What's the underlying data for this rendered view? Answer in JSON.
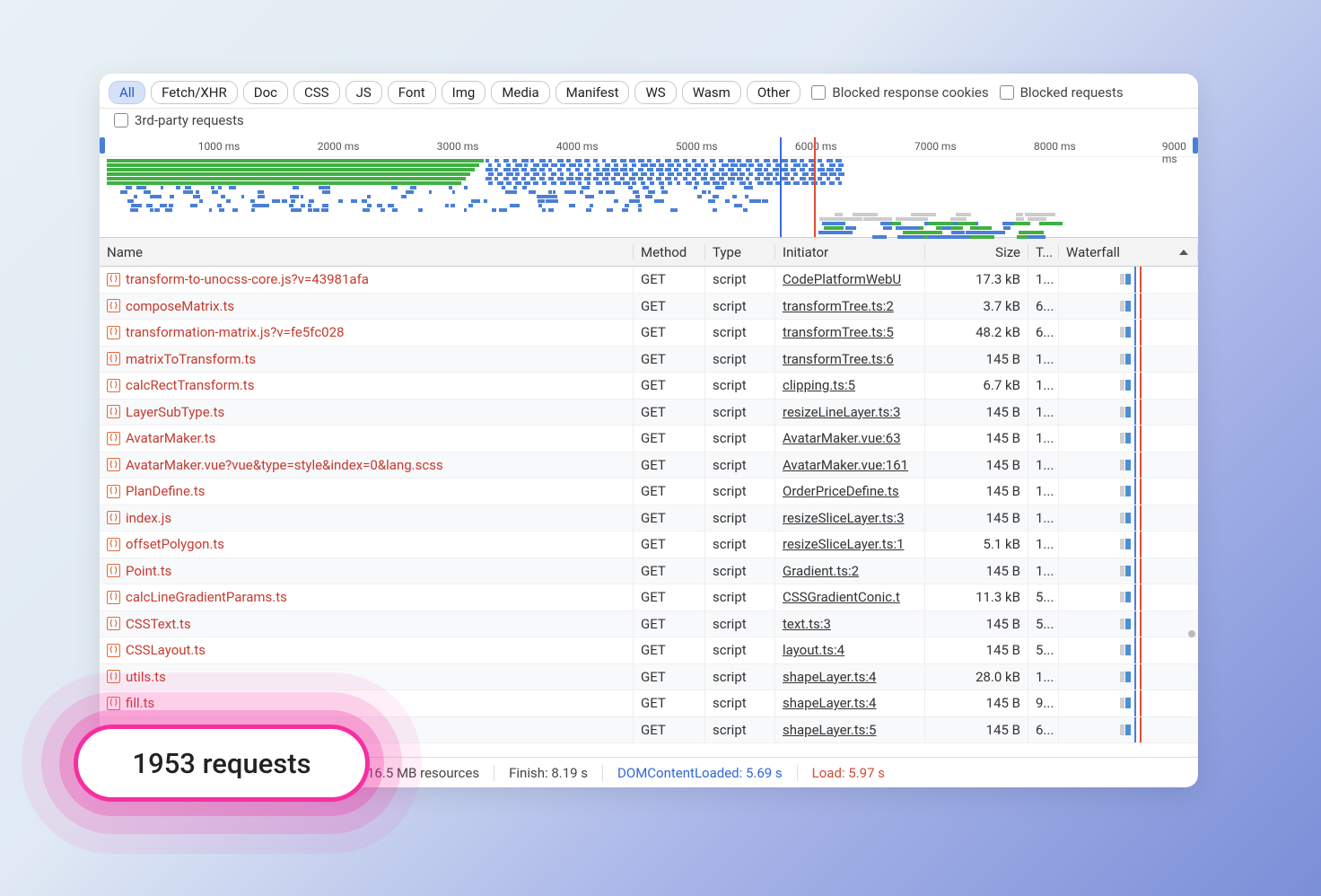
{
  "filters": {
    "chips": [
      "All",
      "Fetch/XHR",
      "Doc",
      "CSS",
      "JS",
      "Font",
      "Img",
      "Media",
      "Manifest",
      "WS",
      "Wasm",
      "Other"
    ],
    "active": "All",
    "checks": {
      "blocked_cookies": "Blocked response cookies",
      "blocked_requests": "Blocked requests",
      "third_party": "3rd-party requests"
    }
  },
  "timeline": {
    "ticks": [
      "1000 ms",
      "2000 ms",
      "3000 ms",
      "4000 ms",
      "5000 ms",
      "6000 ms",
      "7000 ms",
      "8000 ms",
      "9000 ms"
    ]
  },
  "columns": {
    "name": "Name",
    "method": "Method",
    "type": "Type",
    "initiator": "Initiator",
    "size": "Size",
    "time": "T...",
    "waterfall": "Waterfall"
  },
  "rows": [
    {
      "name": "transform-to-unocss-core.js?v=43981afa",
      "method": "GET",
      "type": "script",
      "initiator": "CodePlatformWebU",
      "size": "17.3 kB",
      "time": "1..."
    },
    {
      "name": "composeMatrix.ts",
      "method": "GET",
      "type": "script",
      "initiator": "transformTree.ts:2",
      "size": "3.7 kB",
      "time": "6..."
    },
    {
      "name": "transformation-matrix.js?v=fe5fc028",
      "method": "GET",
      "type": "script",
      "initiator": "transformTree.ts:5",
      "size": "48.2 kB",
      "time": "6..."
    },
    {
      "name": "matrixToTransform.ts",
      "method": "GET",
      "type": "script",
      "initiator": "transformTree.ts:6",
      "size": "145 B",
      "time": "1..."
    },
    {
      "name": "calcRectTransform.ts",
      "method": "GET",
      "type": "script",
      "initiator": "clipping.ts:5",
      "size": "6.7 kB",
      "time": "1..."
    },
    {
      "name": "LayerSubType.ts",
      "method": "GET",
      "type": "script",
      "initiator": "resizeLineLayer.ts:3",
      "size": "145 B",
      "time": "1..."
    },
    {
      "name": "AvatarMaker.ts",
      "method": "GET",
      "type": "script",
      "initiator": "AvatarMaker.vue:63",
      "size": "145 B",
      "time": "1..."
    },
    {
      "name": "AvatarMaker.vue?vue&type=style&index=0&lang.scss",
      "method": "GET",
      "type": "script",
      "initiator": "AvatarMaker.vue:161",
      "size": "145 B",
      "time": "1..."
    },
    {
      "name": "PlanDefine.ts",
      "method": "GET",
      "type": "script",
      "initiator": "OrderPriceDefine.ts",
      "size": "145 B",
      "time": "1..."
    },
    {
      "name": "index.js",
      "method": "GET",
      "type": "script",
      "initiator": "resizeSliceLayer.ts:3",
      "size": "145 B",
      "time": "1..."
    },
    {
      "name": "offsetPolygon.ts",
      "method": "GET",
      "type": "script",
      "initiator": "resizeSliceLayer.ts:1",
      "size": "5.1 kB",
      "time": "1..."
    },
    {
      "name": "Point.ts",
      "method": "GET",
      "type": "script",
      "initiator": "Gradient.ts:2",
      "size": "145 B",
      "time": "1..."
    },
    {
      "name": "calcLineGradientParams.ts",
      "method": "GET",
      "type": "script",
      "initiator": "CSSGradientConic.t",
      "size": "11.3 kB",
      "time": "5..."
    },
    {
      "name": "CSSText.ts",
      "method": "GET",
      "type": "script",
      "initiator": "text.ts:3",
      "size": "145 B",
      "time": "5..."
    },
    {
      "name": "CSSLayout.ts",
      "method": "GET",
      "type": "script",
      "initiator": "layout.ts:4",
      "size": "145 B",
      "time": "5..."
    },
    {
      "name": "utils.ts",
      "method": "GET",
      "type": "script",
      "initiator": "shapeLayer.ts:4",
      "size": "28.0 kB",
      "time": "1..."
    },
    {
      "name": "fill.ts",
      "method": "GET",
      "type": "script",
      "initiator": "shapeLayer.ts:4",
      "size": "145 B",
      "time": "9..."
    },
    {
      "name": "",
      "method": "GET",
      "type": "script",
      "initiator": "shapeLayer.ts:5",
      "size": "145 B",
      "time": "6..."
    }
  ],
  "status": {
    "requests": "1953 requests",
    "resources": "16.5 MB resources",
    "finish": "Finish: 8.19 s",
    "dcl": "DOMContentLoaded: 5.69 s",
    "load": "Load: 5.97 s"
  },
  "callout": "1953 requests"
}
